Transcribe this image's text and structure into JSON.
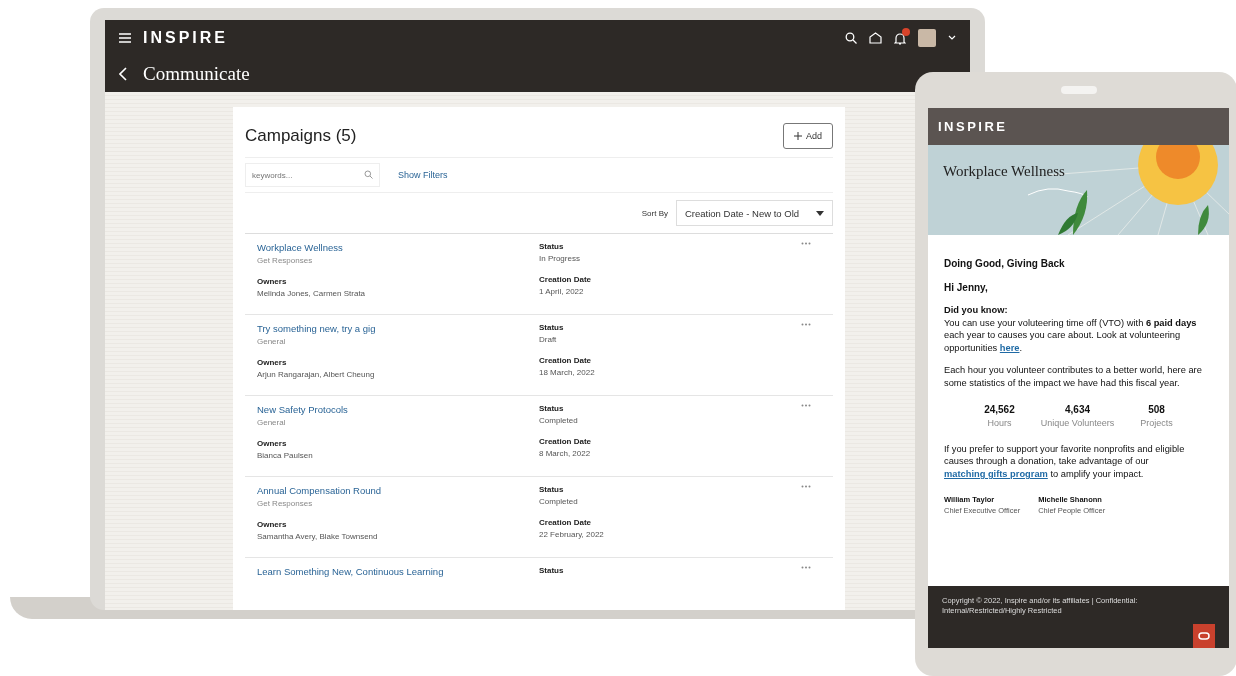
{
  "laptop": {
    "app_name": "INSPIRE",
    "page_title": "Communicate",
    "campaigns": {
      "title": "Campaigns (5)",
      "add_label": "Add",
      "search_placeholder": "keywords...",
      "show_filters": "Show Filters",
      "sort_label": "Sort By",
      "sort_value": "Creation Date - New to Old",
      "items": [
        {
          "name": "Workplace Wellness",
          "type": "Get Responses",
          "status_label": "Status",
          "status": "In Progress",
          "owners_label": "Owners",
          "owners": "Melinda Jones, Carmen Strata",
          "date_label": "Creation Date",
          "date": "1 April, 2022"
        },
        {
          "name": "Try something new, try a gig",
          "type": "General",
          "status_label": "Status",
          "status": "Draft",
          "owners_label": "Owners",
          "owners": "Arjun Rangarajan, Albert Cheung",
          "date_label": "Creation Date",
          "date": "18 March, 2022"
        },
        {
          "name": "New Safety Protocols",
          "type": "General",
          "status_label": "Status",
          "status": "Completed",
          "owners_label": "Owners",
          "owners": "Bianca Paulsen",
          "date_label": "Creation Date",
          "date": "8 March, 2022"
        },
        {
          "name": "Annual Compensation Round",
          "type": "Get Responses",
          "status_label": "Status",
          "status": "Completed",
          "owners_label": "Owners",
          "owners": "Samantha Avery, Blake Townsend",
          "date_label": "Creation Date",
          "date": "22 February, 2022"
        },
        {
          "name": "Learn Something New, Continuous Learning",
          "status_label": "Status"
        }
      ]
    }
  },
  "phone": {
    "brand": "INSPIRE",
    "banner_title": "Workplace Wellness",
    "heading": "Doing Good, Giving Back",
    "greeting": "Hi Jenny,",
    "intro_label": "Did you know:",
    "paragraph_1": {
      "before": "You can use your voluteering time off (VTO) with **6 paid days** each year to causes you care about. Look at volunteering opportunities ",
      "link": "here",
      "after": "."
    },
    "paragraph_2": "Each hour you volunteer contributes to a better world, here are some statistics of the impact we have had this fiscal year.",
    "stats": [
      {
        "value": "24,562",
        "label": "Hours"
      },
      {
        "value": "4,634",
        "label": "Unique Volunteers"
      },
      {
        "value": "508",
        "label": "Projects"
      }
    ],
    "paragraph_3": {
      "before": "If you prefer to support your favorite nonprofits and eligible causes through a donation, take advantage of our ",
      "link": "matching gifts program",
      "after": " to amplify your impact."
    },
    "signatures": [
      {
        "name": "William Taylor",
        "role": "Chief Executive Officer"
      },
      {
        "name": "Michelle Shanonn",
        "role": "Chief People Officer"
      }
    ],
    "footer": "Copyright © 2022, Inspire and/or its affiliates | Confidential: Internal/Restricted/Highly Restricted"
  }
}
